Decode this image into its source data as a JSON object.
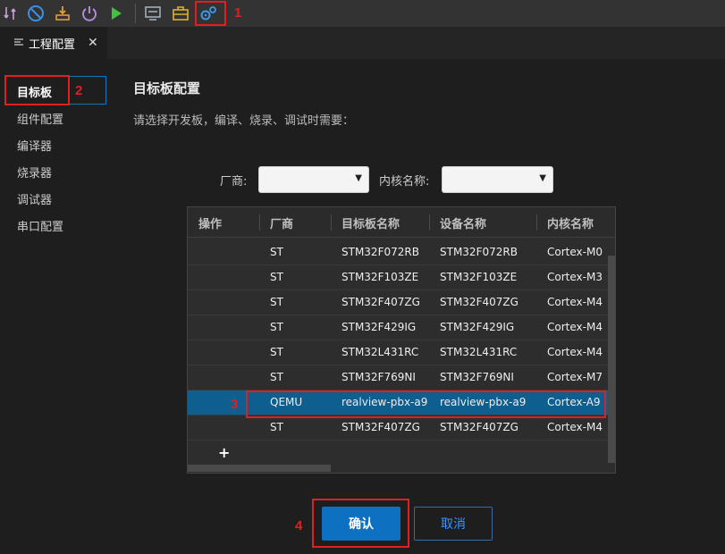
{
  "colors": {
    "accent": "#0e70c0",
    "selected_row": "#0e5f8f",
    "annotation": "#e02020"
  },
  "toolbar": {
    "icons": [
      "build-icon",
      "stop-icon",
      "download-icon",
      "power-icon",
      "run-icon",
      "monitor-icon",
      "toolbox-icon",
      "gears-icon"
    ]
  },
  "annotations": {
    "n1": "1",
    "n2": "2",
    "n3": "3",
    "n4": "4"
  },
  "tab": {
    "label": "工程配置",
    "close": "✕"
  },
  "sidebar": {
    "items": [
      {
        "label": "目标板"
      },
      {
        "label": "组件配置"
      },
      {
        "label": "编译器"
      },
      {
        "label": "烧录器"
      },
      {
        "label": "调试器"
      },
      {
        "label": "串口配置"
      }
    ]
  },
  "main": {
    "title": "目标板配置",
    "description": "请选择开发板，编译、烧录、调试时需要：",
    "vendor_label": "厂商:",
    "vendor_value": "",
    "core_label": "内核名称:",
    "core_value": ""
  },
  "table": {
    "headers": [
      "操作",
      "厂商",
      "目标板名称",
      "设备名称",
      "内核名称"
    ],
    "rows": [
      [
        "",
        "ST",
        "STM32F072RB",
        "STM32F072RB",
        "Cortex-M0"
      ],
      [
        "",
        "ST",
        "STM32F103ZE",
        "STM32F103ZE",
        "Cortex-M3"
      ],
      [
        "",
        "ST",
        "STM32F407ZG",
        "STM32F407ZG",
        "Cortex-M4"
      ],
      [
        "",
        "ST",
        "STM32F429IG",
        "STM32F429IG",
        "Cortex-M4"
      ],
      [
        "",
        "ST",
        "STM32L431RC",
        "STM32L431RC",
        "Cortex-M4"
      ],
      [
        "",
        "ST",
        "STM32F769NI",
        "STM32F769NI",
        "Cortex-M7"
      ],
      [
        "",
        "QEMU",
        "realview-pbx-a9",
        "realview-pbx-a9",
        "Cortex-A9"
      ],
      [
        "",
        "ST",
        "STM32F407ZG",
        "STM32F407ZG",
        "Cortex-M4"
      ]
    ],
    "selected_row": 6,
    "add_label": "+"
  },
  "buttons": {
    "confirm": "确认",
    "cancel": "取消"
  }
}
